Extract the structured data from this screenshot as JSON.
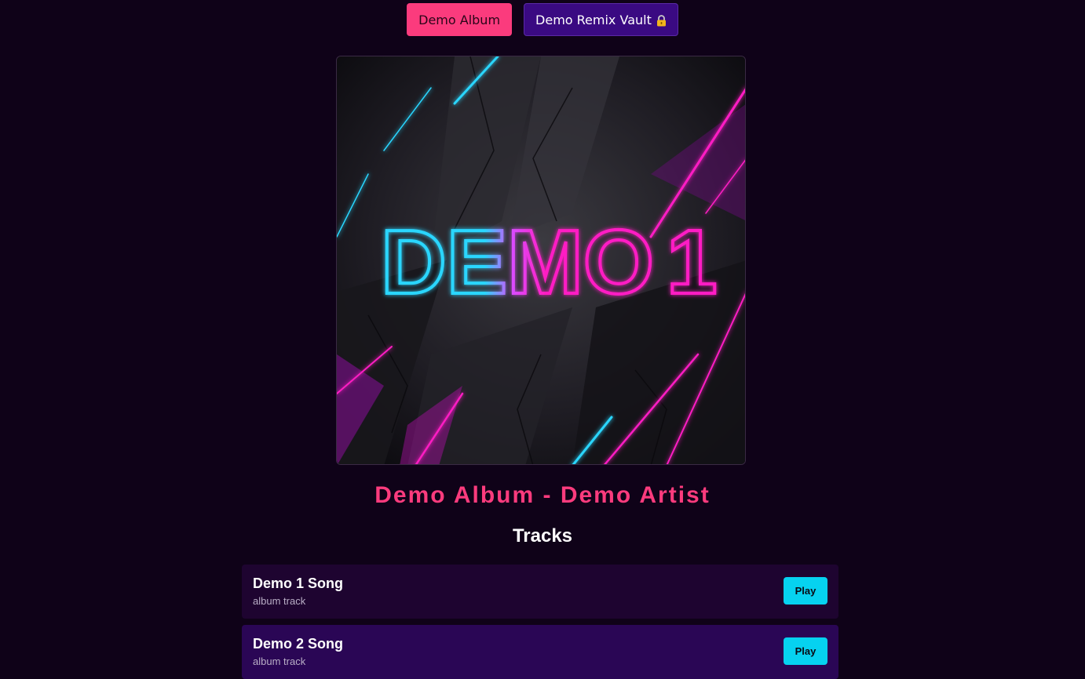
{
  "tabs": [
    {
      "label": "Demo Album",
      "active": true
    },
    {
      "label": "Demo Remix Vault",
      "icon": "lock-icon"
    }
  ],
  "cover": {
    "text_cyan": "DEMO",
    "text_pink": "1",
    "colors": {
      "cyan": "#29d6ff",
      "pink": "#ff1fc4",
      "bg": "#141218"
    }
  },
  "album": {
    "title": "Demo Album - Demo Artist"
  },
  "tracks_heading": "Tracks",
  "tracks": [
    {
      "name": "Demo 1 Song",
      "subtitle": "album track",
      "play_label": "Play"
    },
    {
      "name": "Demo 2 Song",
      "subtitle": "album track",
      "play_label": "Play"
    }
  ],
  "colors": {
    "background": "#0f0218",
    "accent": "#fb3b7d",
    "vault": "#3a0a82",
    "play": "#06d2f0"
  }
}
